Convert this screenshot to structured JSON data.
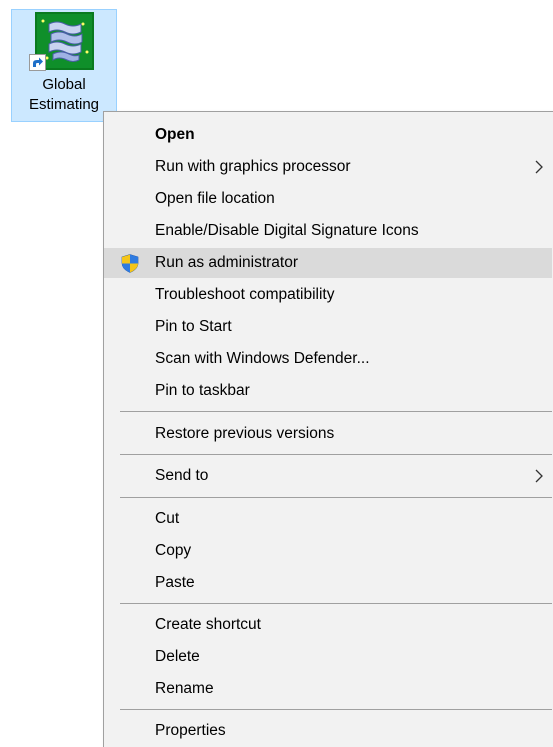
{
  "desktop_shortcut": {
    "label_line1": "Global",
    "label_line2": "Estimating",
    "icon": "global-estimating-app-icon",
    "overlay": "shortcut-arrow-icon"
  },
  "context_menu": {
    "items": {
      "open": "Open",
      "run_gpu": "Run with graphics processor",
      "open_location": "Open file location",
      "signature_icons": "Enable/Disable Digital Signature Icons",
      "run_admin": "Run as administrator",
      "troubleshoot": "Troubleshoot compatibility",
      "pin_start": "Pin to Start",
      "scan_defender": "Scan with Windows Defender...",
      "pin_taskbar": "Pin to taskbar",
      "restore": "Restore previous versions",
      "send_to": "Send to",
      "cut": "Cut",
      "copy": "Copy",
      "paste": "Paste",
      "create_shortcut": "Create shortcut",
      "delete": "Delete",
      "rename": "Rename",
      "properties": "Properties"
    },
    "highlighted_item": "Run as administrator",
    "icons": {
      "run_admin": "uac-shield-icon",
      "submenu": "chevron-right-icon"
    },
    "colors": {
      "menu_background": "#f2f2f2",
      "highlight": "#dadada",
      "selection_background": "#cce8ff"
    }
  }
}
